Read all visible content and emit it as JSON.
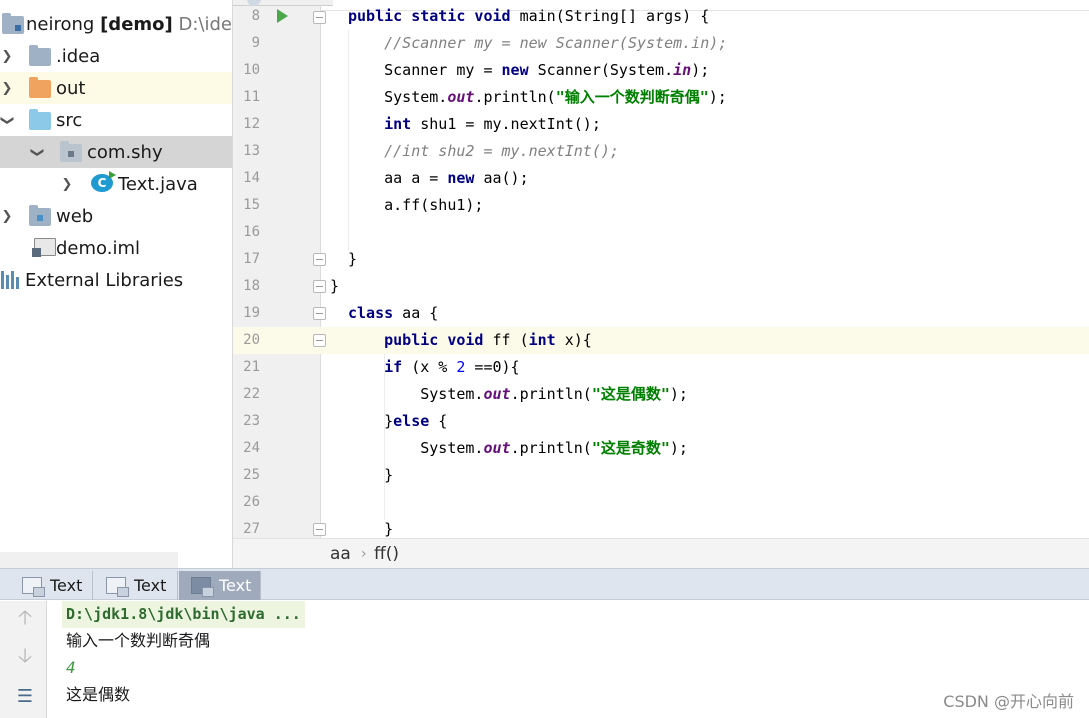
{
  "project": {
    "root": {
      "name": "neirong",
      "module": "[demo]",
      "path": "D:\\ide\\"
    },
    "items": [
      {
        "label": ".idea"
      },
      {
        "label": "out"
      },
      {
        "label": "src"
      },
      {
        "label": "com.shy"
      },
      {
        "label": "Text.java",
        "icon_text": "C"
      },
      {
        "label": "web"
      },
      {
        "label": "demo.iml"
      },
      {
        "label": "External Libraries"
      }
    ]
  },
  "editor": {
    "lines": [
      {
        "n": "8"
      },
      {
        "n": "9"
      },
      {
        "n": "10"
      },
      {
        "n": "11"
      },
      {
        "n": "12"
      },
      {
        "n": "13"
      },
      {
        "n": "14"
      },
      {
        "n": "15"
      },
      {
        "n": "16"
      },
      {
        "n": "17"
      },
      {
        "n": "18"
      },
      {
        "n": "19"
      },
      {
        "n": "20"
      },
      {
        "n": "21"
      },
      {
        "n": "22"
      },
      {
        "n": "23"
      },
      {
        "n": "24"
      },
      {
        "n": "25"
      },
      {
        "n": "26"
      },
      {
        "n": "27"
      }
    ],
    "breadcrumb": [
      "aa",
      "ff()"
    ]
  },
  "run": {
    "tabs": [
      "Text",
      "Text",
      "Text"
    ],
    "console": {
      "command": "D:\\jdk1.8\\jdk\\bin\\java ...",
      "prompt": "输入一个数判断奇偶",
      "input": "4",
      "result": "这是偶数"
    }
  },
  "watermark": "CSDN @开心向前",
  "colors": {
    "keyword": "#000080",
    "string": "#008000",
    "comment": "#808080",
    "field": "#660e7a",
    "number": "#0000ff",
    "current_line": "#fcfae9",
    "active_tab": "#9fabbd"
  }
}
